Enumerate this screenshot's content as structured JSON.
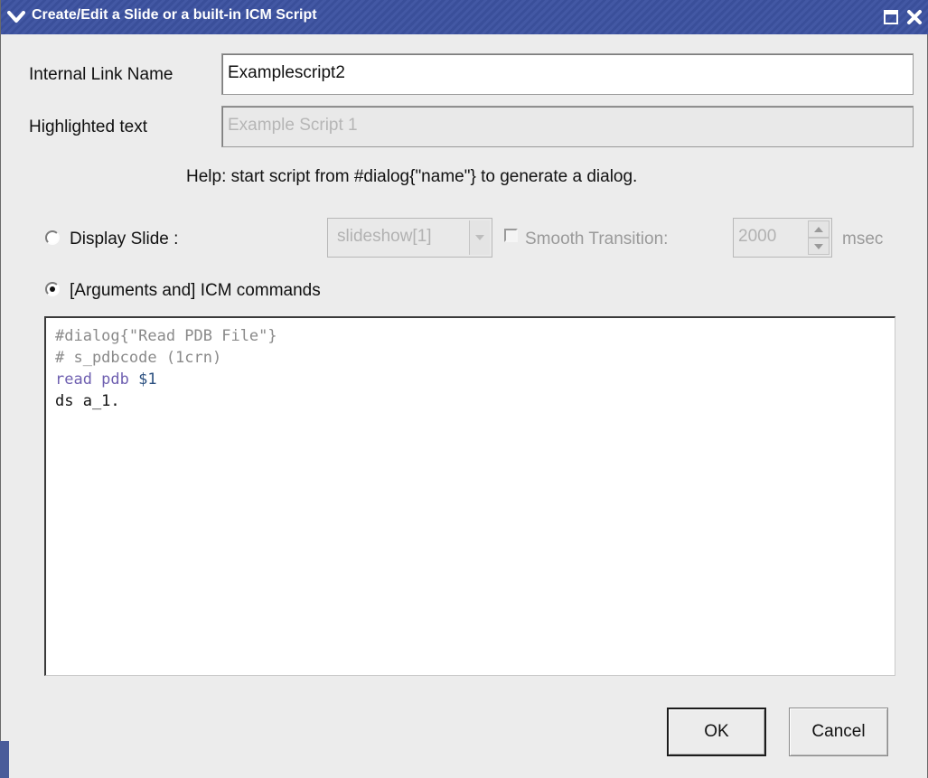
{
  "window": {
    "title": "Create/Edit a Slide or a built-in ICM Script",
    "menu_icon": "chevron-down-icon",
    "maximize_icon": "maximize-icon",
    "close_icon": "close-icon"
  },
  "form": {
    "link_name_label": "Internal Link Name",
    "link_name_value": "Examplescript2",
    "highlighted_label": "Highlighted text",
    "highlighted_placeholder": "Example Script 1",
    "help_text": "Help: start script from #dialog{\"name\"} to generate a dialog."
  },
  "display_slide": {
    "label": "Display Slide :",
    "selected": false,
    "slideshow_value": "slideshow[1]",
    "smooth_label": "Smooth Transition:",
    "smooth_checked": false,
    "duration_value": "2000",
    "duration_unit": "msec"
  },
  "icm": {
    "label": "[Arguments and] ICM commands",
    "selected": true
  },
  "script": {
    "lines": [
      {
        "parts": [
          {
            "text": "#dialog{\"Read PDB File\"}",
            "color": "#8a8a8a"
          }
        ]
      },
      {
        "parts": [
          {
            "text": "# s_pdbcode (1crn)",
            "color": "#8a8a8a"
          }
        ]
      },
      {
        "parts": [
          {
            "text": "read pdb ",
            "color": "#6e5fb0"
          },
          {
            "text": "$1",
            "color": "#2a4f7f"
          }
        ]
      },
      {
        "parts": [
          {
            "text": "ds a_1.",
            "color": "#111111"
          }
        ]
      }
    ]
  },
  "buttons": {
    "ok_label": "OK",
    "cancel_label": "Cancel"
  },
  "colors": {
    "titlebar": "#4358a4",
    "window_bg": "#ececec",
    "comment": "#8a8a8a",
    "keyword": "#6e5fb0"
  }
}
